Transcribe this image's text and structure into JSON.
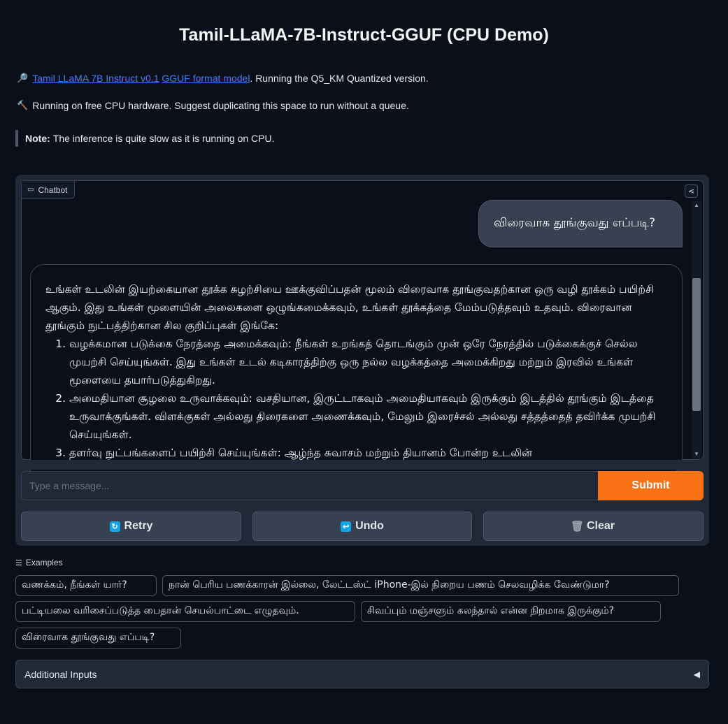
{
  "title": "Tamil-LLaMA-7B-Instruct-GGUF (CPU Demo)",
  "intro": {
    "icon": "magnifier-icon",
    "link1": "Tamil LLaMA 7B Instruct v0.1",
    "link2": "GGUF format model",
    "rest": ". Running the Q5_KM Quantized version."
  },
  "hardware": {
    "icon": "hammer-icon",
    "text": "Running on free CPU hardware. Suggest duplicating this space to run without a queue."
  },
  "note": {
    "label": "Note:",
    "text": "The inference is quite slow as it is running on CPU."
  },
  "chatbot": {
    "label": "Chatbot",
    "user_message": "விரைவாக தூங்குவது எப்படி?",
    "bot_intro": "உங்கள் உடலின் இயற்கையான தூக்க சுழற்சியை ஊக்குவிப்பதன் மூலம் விரைவாக தூங்குவதற்கான ஒரு வழி தூக்கம் பயிற்சி ஆகும். இது உங்கள் மூளையின் அலைகளை ஒழுங்கமைக்கவும், உங்கள் தூக்கத்தை மேம்படுத்தவும் உதவும். விரைவான தூங்கும் நுட்பத்திற்கான சில குறிப்புகள் இங்கே:",
    "bot_items": [
      "வழக்கமான படுக்கை நேரத்தை அமைக்கவும்: நீங்கள் உறங்கத் தொடங்கும் முன் ஒரே நேரத்தில் படுக்கைக்குச் செல்ல முயற்சி செய்யுங்கள். இது உங்கள் உடல் கடிகாரத்திற்கு ஒரு நல்ல வழக்கத்தை அமைக்கிறது மற்றும் இரவில் உங்கள் மூளையை தயார்படுத்துகிறது.",
      "அமைதியான சூழலை உருவாக்கவும்: வசதியான, இருட்டாகவும் அமைதியாகவும் இருக்கும் இடத்தில் தூங்கும் இடத்தை உருவாக்குங்கள். விளக்குகள் அல்லது திரைகளை அணைக்கவும், மேலும் இரைச்சல் அல்லது சத்தத்தைத் தவிர்க்க முயற்சி செய்யுங்கள்.",
      "தளர்வு நுட்பங்களைப் பயிற்சி செய்யுங்கள்: ஆழ்ந்த சுவாசம் மற்றும் தியானம் போன்ற உடலின்"
    ]
  },
  "input": {
    "placeholder": "Type a message...",
    "submit_label": "Submit"
  },
  "buttons": {
    "retry": "Retry",
    "undo": "Undo",
    "clear": "Clear"
  },
  "examples": {
    "label": "Examples",
    "items": [
      "வணக்கம், நீங்கள் யார்?",
      "நான் பெரிய பணக்காரன் இல்லை, லேட்டஸ்ட் iPhone-இல் நிறைய பணம் செலவழிக்க வேண்டுமா?",
      "பட்டியலை வரிசைப்படுத்த பைதான் செயல்பாட்டை எழுதவும்.",
      "சிவப்பும் மஞ்சளும் கலந்தால் என்ன நிறமாக இருக்கும்?",
      "விரைவாக தூங்குவது எப்படி?"
    ]
  },
  "additional_inputs": {
    "label": "Additional Inputs"
  },
  "colors": {
    "background": "#0b0f19",
    "panel": "#1f2937",
    "accent": "#f97316",
    "link": "#3b82f6"
  }
}
